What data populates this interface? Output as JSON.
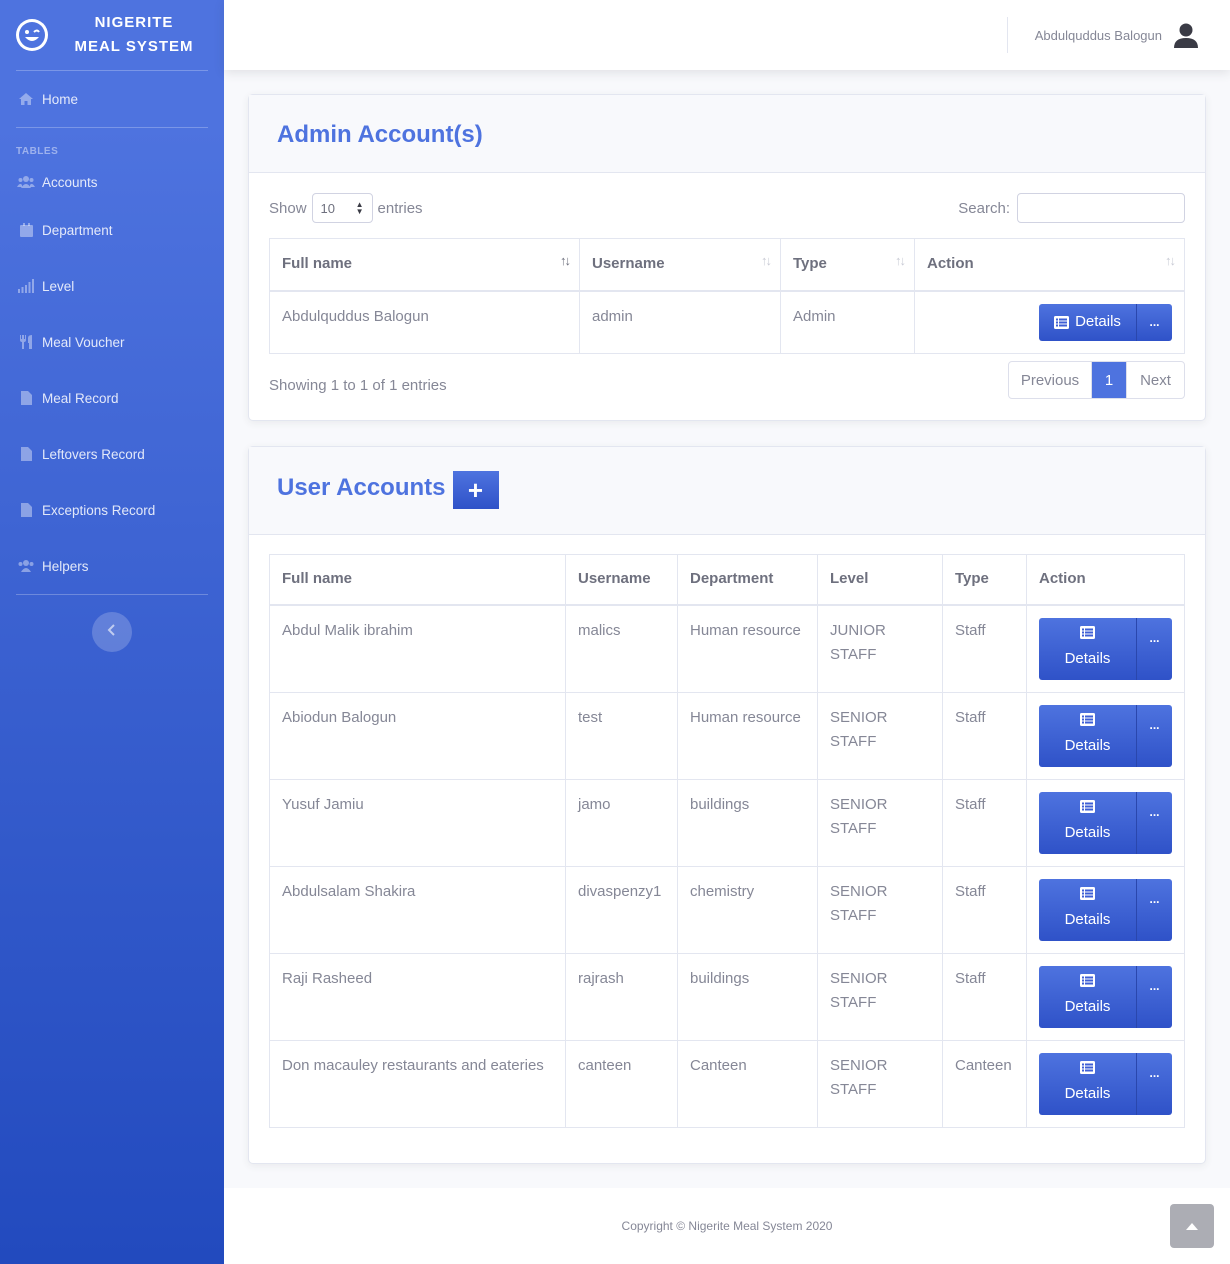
{
  "brand": {
    "line1": "NIGERITE",
    "line2": "MEAL SYSTEM",
    "icon": "laugh-wink-icon"
  },
  "sidebar": {
    "home": "Home",
    "heading": "TABLES",
    "items": [
      {
        "label": "Accounts",
        "icon": "users-icon"
      },
      {
        "label": "Department",
        "icon": "calendar-icon"
      },
      {
        "label": "Level",
        "icon": "signal-icon"
      },
      {
        "label": "Meal Voucher",
        "icon": "utensils-icon"
      },
      {
        "label": "Meal Record",
        "icon": "file-icon"
      },
      {
        "label": "Leftovers Record",
        "icon": "file-icon"
      },
      {
        "label": "Exceptions Record",
        "icon": "file-icon"
      },
      {
        "label": "Helpers",
        "icon": "users-icon"
      }
    ]
  },
  "topbar": {
    "user_name": "Abdulquddus Balogun"
  },
  "admin": {
    "title": "Admin Account(s)",
    "show_label": "Show",
    "entries_value": "10",
    "entries_label": "entries",
    "search_label": "Search:",
    "search_value": "",
    "columns": [
      "Full name",
      "Username",
      "Type",
      "Action"
    ],
    "rows": [
      {
        "full_name": "Abdulquddus Balogun",
        "username": "admin",
        "type": "Admin"
      }
    ],
    "details_label": "Details",
    "more_label": "...",
    "info": "Showing 1 to 1 of 1 entries",
    "pager": {
      "prev": "Previous",
      "page": "1",
      "next": "Next"
    }
  },
  "users": {
    "title": "User Accounts",
    "add_label": "+",
    "columns": [
      "Full name",
      "Username",
      "Department",
      "Level",
      "Type",
      "Action"
    ],
    "rows": [
      {
        "full_name": "Abdul Malik ibrahim",
        "username": "malics",
        "department": "Human resource",
        "level": "JUNIOR STAFF",
        "type": "Staff"
      },
      {
        "full_name": "Abiodun Balogun",
        "username": "test",
        "department": "Human resource",
        "level": "SENIOR STAFF",
        "type": "Staff"
      },
      {
        "full_name": "Yusuf Jamiu",
        "username": "jamo",
        "department": "buildings",
        "level": "SENIOR STAFF",
        "type": "Staff"
      },
      {
        "full_name": "Abdulsalam Shakira",
        "username": "divaspenzy1",
        "department": "chemistry",
        "level": "SENIOR STAFF",
        "type": "Staff"
      },
      {
        "full_name": "Raji Rasheed",
        "username": "rajrash",
        "department": "buildings",
        "level": "SENIOR STAFF",
        "type": "Staff"
      },
      {
        "full_name": "Don macauley restaurants and eateries",
        "username": "canteen",
        "department": "Canteen",
        "level": "SENIOR STAFF",
        "type": "Canteen"
      }
    ],
    "details_label": "Details",
    "more_label": "..."
  },
  "footer": {
    "copyright": "Copyright © Nigerite Meal System 2020"
  },
  "colors": {
    "primary": "#4e73df",
    "primary_dark": "#224abe",
    "text": "#858796"
  }
}
